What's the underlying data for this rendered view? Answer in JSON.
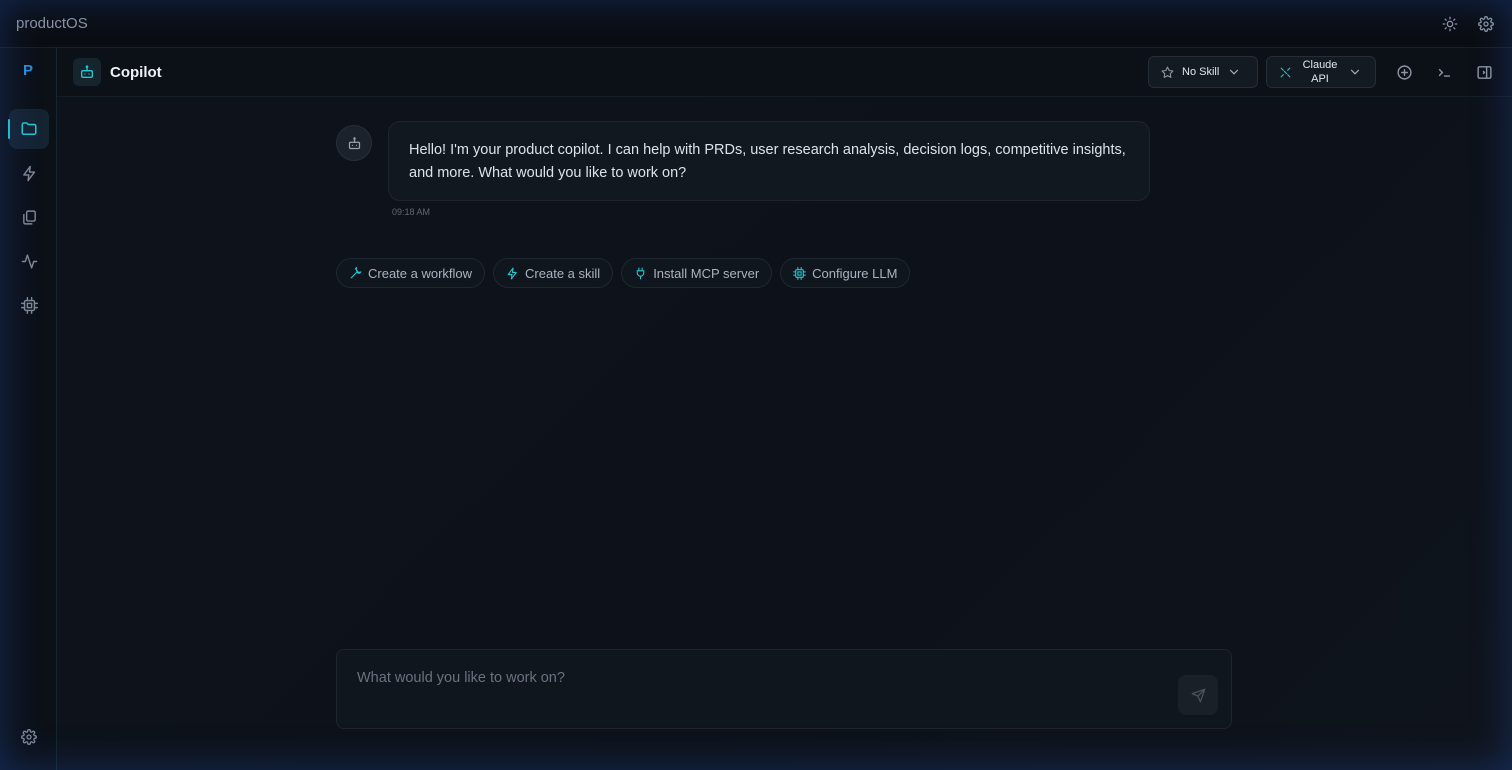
{
  "app": {
    "title": "productOS"
  },
  "titlebar": {
    "icons": [
      "sun-icon",
      "gear-icon"
    ]
  },
  "sidebar": {
    "logo": "P",
    "items": [
      {
        "name": "folder-icon",
        "active": true
      },
      {
        "name": "lightning-icon",
        "active": false
      },
      {
        "name": "documents-icon",
        "active": false
      },
      {
        "name": "activity-icon",
        "active": false
      },
      {
        "name": "chip-icon",
        "active": false
      }
    ],
    "bottom_icon": "gear-icon"
  },
  "header": {
    "title": "Copilot",
    "skill_select": {
      "value": "No Skill"
    },
    "model_select": {
      "value_line1": "Claude",
      "value_line2": "API"
    },
    "buttons": [
      "add-circle-icon",
      "terminal-icon",
      "panel-toggle-icon"
    ]
  },
  "chat": {
    "messages": [
      {
        "role": "assistant",
        "text": "Hello! I'm your product copilot. I can help with PRDs, user research analysis, decision logs, competitive insights, and more. What would you like to work on?",
        "time": "09:18 AM"
      }
    ],
    "suggestions": [
      {
        "label": "Create a workflow",
        "icon": "wrench-icon"
      },
      {
        "label": "Create a skill",
        "icon": "lightning-icon"
      },
      {
        "label": "Install MCP server",
        "icon": "plug-icon"
      },
      {
        "label": "Configure LLM",
        "icon": "chip-icon"
      }
    ]
  },
  "composer": {
    "placeholder": "What would you like to work on?",
    "value": ""
  },
  "colors": {
    "accent": "#1fc8d6",
    "logo": "#2b8ee0",
    "background": "#0b0f16"
  }
}
